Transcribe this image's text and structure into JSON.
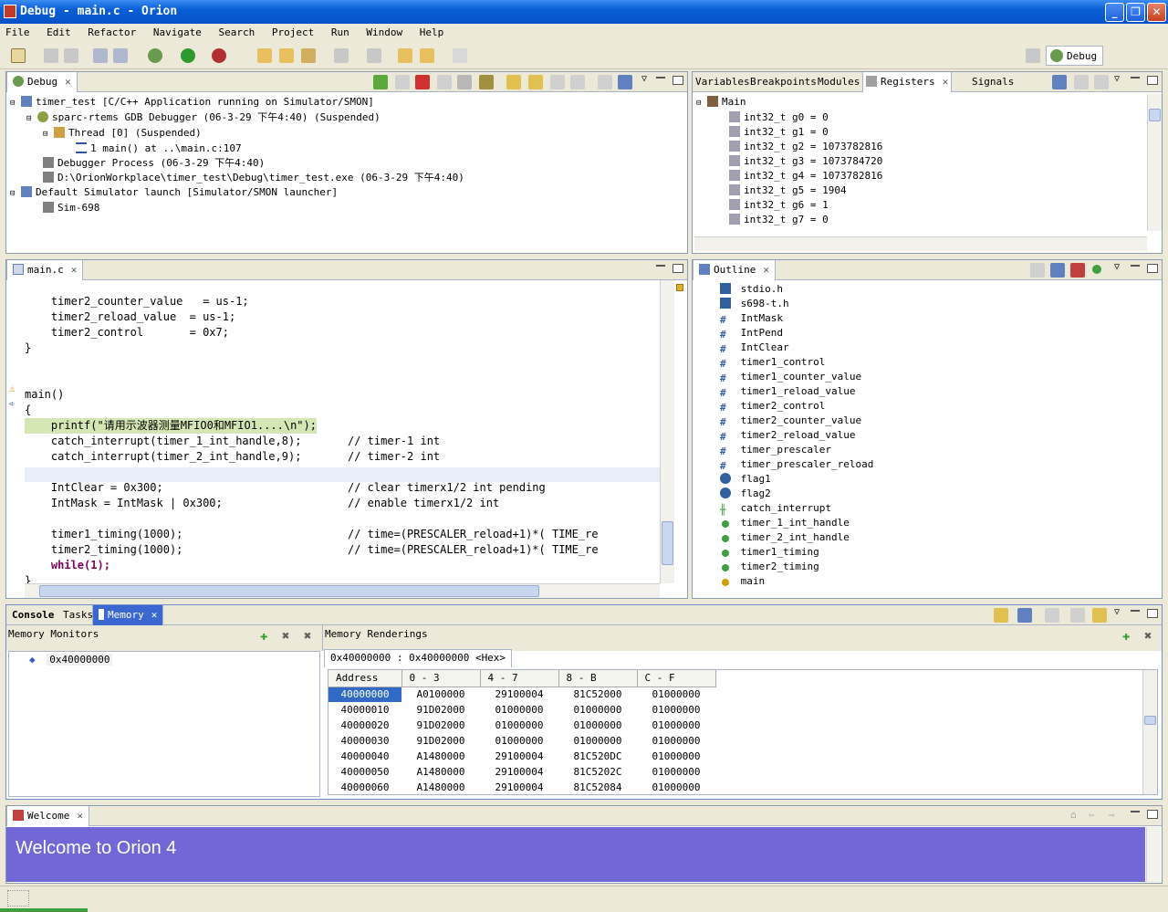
{
  "window": {
    "title": "Debug - main.c - Orion"
  },
  "menu": [
    "File",
    "Edit",
    "Refactor",
    "Navigate",
    "Search",
    "Project",
    "Run",
    "Window",
    "Help"
  ],
  "perspective": {
    "label": "Debug"
  },
  "debug_view": {
    "tab": "Debug",
    "tree": [
      "timer_test [C/C++ Application running on Simulator/SMON]",
      "sparc-rtems GDB Debugger (06-3-29 下午4:40) (Suspended)",
      "Thread [0] (Suspended)",
      "1 main() at ..\\main.c:107",
      "Debugger Process (06-3-29 下午4:40)",
      "D:\\OrionWorkplace\\timer_test\\Debug\\timer_test.exe (06-3-29 下午4:40)",
      "Default Simulator launch [Simulator/SMON launcher]",
      "Sim-698"
    ]
  },
  "registers_view": {
    "tabs": [
      "Variables",
      "Breakpoints",
      "Modules",
      "Registers",
      "Signals"
    ],
    "root": "Main",
    "rows": [
      "int32_t g0 = 0",
      "int32_t g1 = 0",
      "int32_t g2 = 1073782816",
      "int32_t g3 = 1073784720",
      "int32_t g4 = 1073782816",
      "int32_t g5 = 1904",
      "int32_t g6 = 1",
      "int32_t g7 = 0"
    ]
  },
  "editor": {
    "tab": "main.c",
    "lines": [
      "    timer2_counter_value   = us-1;",
      "    timer2_reload_value  = us-1;",
      "    timer2_control       = 0x7;",
      "}",
      "",
      "",
      "main()",
      "{",
      "    printf(\"请用示波器测量MFIO0和MFIO1....\\n\");",
      "    catch_interrupt(timer_1_int_handle,8);       // timer-1 int",
      "    catch_interrupt(timer_2_int_handle,9);       // timer-2 int",
      "",
      "    IntClear = 0x300;                            // clear timerx1/2 int pending",
      "    IntMask = IntMask | 0x300;                   // enable timerx1/2 int",
      "",
      "    timer1_timing(1000);                         // time=(PRESCALER_reload+1)*( TIME_re",
      "    timer2_timing(1000);                         // time=(PRESCALER_reload+1)*( TIME_re",
      "    while(1);",
      "}"
    ]
  },
  "outline": {
    "tab": "Outline",
    "items": [
      "stdio.h",
      "s698-t.h",
      "IntMask",
      "IntPend",
      "IntClear",
      "timer1_control",
      "timer1_counter_value",
      "timer1_reload_value",
      "timer2_control",
      "timer2_counter_value",
      "timer2_reload_value",
      "timer_prescaler",
      "timer_prescaler_reload",
      "flag1",
      "flag2",
      "catch_interrupt",
      "timer_1_int_handle",
      "timer_2_int_handle",
      "timer1_timing",
      "timer2_timing",
      "main"
    ]
  },
  "bottom_tabs": [
    "Console",
    "Tasks",
    "Memory"
  ],
  "memory": {
    "monitors_label": "Memory Monitors",
    "renderings_label": "Memory Renderings",
    "monitor": "0x40000000",
    "rendering_tab": "0x40000000 : 0x40000000 <Hex>",
    "columns": [
      "Address",
      "0 - 3",
      "4 - 7",
      "8 - B",
      "C - F"
    ],
    "rows": [
      [
        "40000000",
        "A0100000",
        "29100004",
        "81C52000",
        "01000000"
      ],
      [
        "40000010",
        "91D02000",
        "01000000",
        "01000000",
        "01000000"
      ],
      [
        "40000020",
        "91D02000",
        "01000000",
        "01000000",
        "01000000"
      ],
      [
        "40000030",
        "91D02000",
        "01000000",
        "01000000",
        "01000000"
      ],
      [
        "40000040",
        "A1480000",
        "29100004",
        "81C520DC",
        "01000000"
      ],
      [
        "40000050",
        "A1480000",
        "29100004",
        "81C5202C",
        "01000000"
      ],
      [
        "40000060",
        "A1480000",
        "29100004",
        "81C52084",
        "01000000"
      ]
    ]
  },
  "welcome": {
    "tab": "Welcome",
    "banner": "Welcome to Orion 4"
  }
}
